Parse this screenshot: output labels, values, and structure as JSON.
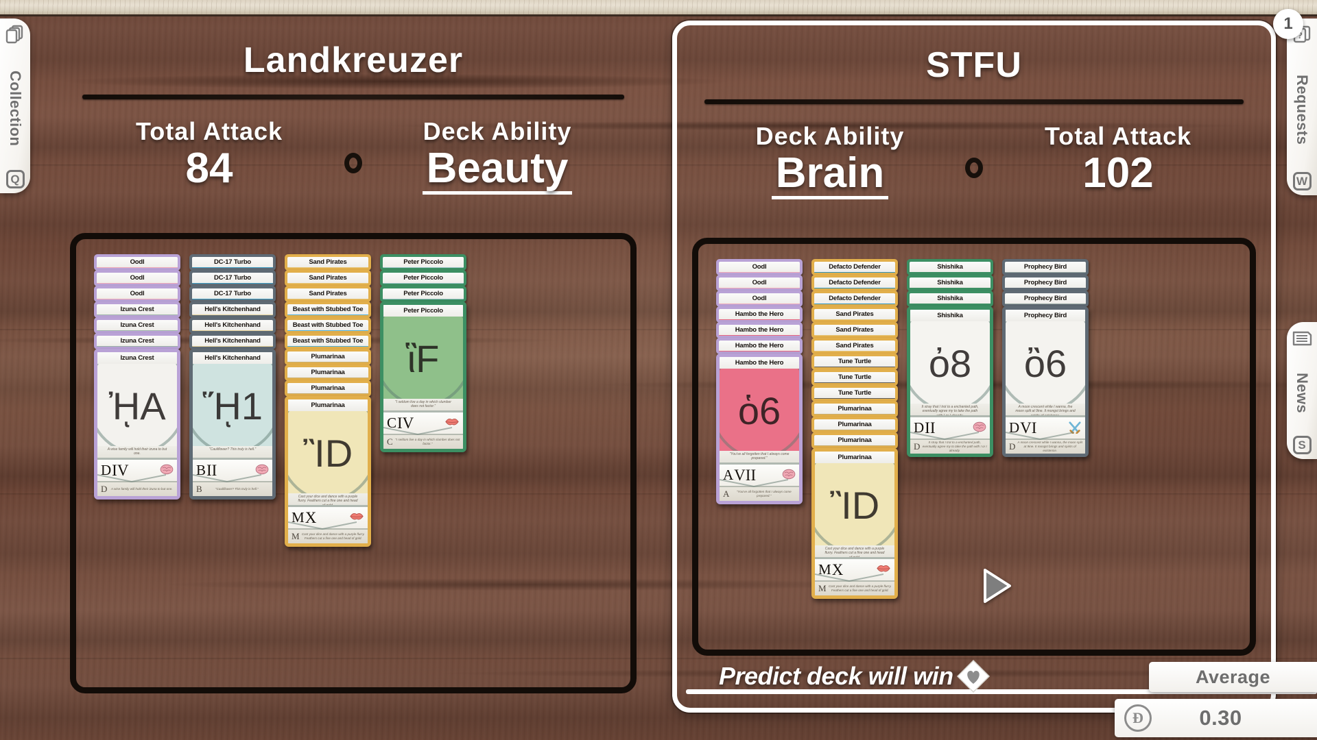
{
  "sidebar_left": {
    "tabs": [
      {
        "id": "collection",
        "label": "Collection",
        "key": "Q",
        "icon": "cards-stack-icon"
      }
    ]
  },
  "sidebar_right": {
    "tabs": [
      {
        "id": "requests",
        "label": "Requests",
        "key": "W",
        "icon": "question-cards-icon",
        "badge": "1"
      },
      {
        "id": "news",
        "label": "News",
        "key": "S",
        "icon": "newspaper-icon",
        "badge": ""
      }
    ]
  },
  "decks": [
    {
      "name": "Landkreuzer",
      "selected": false,
      "stats": [
        {
          "label": "Total Attack",
          "value": "84",
          "underlined": false
        },
        {
          "label": "Deck Ability",
          "value": "Beauty",
          "underlined": true
        }
      ],
      "stacks": [
        {
          "frame_color": "#b9a2d6",
          "art_color": "#f0aab8",
          "cards": [
            {
              "title": "Oodl",
              "art": "#f0aab8"
            },
            {
              "title": "Oodl",
              "art": "#f0aab8"
            },
            {
              "title": "Oodl",
              "art": "#f0aab8"
            },
            {
              "title": "Izuna Crest",
              "art": "#9db5a8"
            },
            {
              "title": "Izuna Crest",
              "art": "#9db5a8"
            },
            {
              "title": "Izuna Crest",
              "art": "#9db5a8"
            }
          ],
          "bottom": {
            "title": "Izuna Crest",
            "grade": "D",
            "numeral": "IV",
            "ability_icon": "brain-icon",
            "art_color": "#f3f2ee",
            "motif": "ᾘA",
            "quote": "A wise family will hold their izuna to but one."
          }
        },
        {
          "frame_color": "#5f6a74",
          "art_color": "#3f9ec4",
          "cards": [
            {
              "title": "DC-17 Turbo",
              "art": "#3f9ec4"
            },
            {
              "title": "DC-17 Turbo",
              "art": "#3f9ec4"
            },
            {
              "title": "DC-17 Turbo",
              "art": "#3f9ec4"
            },
            {
              "title": "Hell's Kitchenhand",
              "art": "#e6d39a"
            },
            {
              "title": "Hell's Kitchenhand",
              "art": "#e6d39a"
            },
            {
              "title": "Hell's Kitchenhand",
              "art": "#e6d39a"
            }
          ],
          "bottom": {
            "title": "Hell's Kitchenhand",
            "grade": "B",
            "numeral": "II",
            "ability_icon": "brain-icon",
            "art_color": "#cfe3e0",
            "motif": "ᾝ1",
            "quote": "\"Cauliflower? This truly is hell.\""
          }
        },
        {
          "frame_color": "#e2af4b",
          "art_color": "#e6c67a",
          "cards": [
            {
              "title": "Sand Pirates",
              "art": "#e6c67a"
            },
            {
              "title": "Sand Pirates",
              "art": "#e6c67a"
            },
            {
              "title": "Sand Pirates",
              "art": "#e6c67a"
            },
            {
              "title": "Beast with Stubbed Toe",
              "art": "#4fb0dc"
            },
            {
              "title": "Beast with Stubbed Toe",
              "art": "#4fb0dc"
            },
            {
              "title": "Beast with Stubbed Toe",
              "art": "#4fb0dc"
            },
            {
              "title": "Plumarinaa",
              "art": "#c9ae6e"
            },
            {
              "title": "Plumarinaa",
              "art": "#c9ae6e"
            },
            {
              "title": "Plumarinaa",
              "art": "#c9ae6e"
            }
          ],
          "bottom": {
            "title": "Plumarinaa",
            "grade": "M",
            "numeral": "X",
            "ability_icon": "lips-icon",
            "art_color": "#f0e6b8",
            "motif": "ἺD",
            "quote": "Cast your dice and dance with a purple flurry. Feathers cut a fine one and head of gold."
          }
        },
        {
          "frame_color": "#3c8f63",
          "art_color": "#7fbf86",
          "cards": [
            {
              "title": "Peter Piccolo",
              "art": "#9dc6c8"
            },
            {
              "title": "Peter Piccolo",
              "art": "#9dc6c8"
            },
            {
              "title": "Peter Piccolo",
              "art": "#9dc6c8"
            }
          ],
          "bottom": {
            "title": "Peter Piccolo",
            "grade": "C",
            "numeral": "IV",
            "ability_icon": "lips-icon",
            "art_color": "#8fc08a",
            "motif": "ἳF",
            "quote": "\"I seldom live a day in which slumber does not factor.\""
          }
        }
      ]
    },
    {
      "name": "STFU",
      "selected": true,
      "stats": [
        {
          "label": "Deck Ability",
          "value": "Brain",
          "underlined": true
        },
        {
          "label": "Total Attack",
          "value": "102",
          "underlined": false
        }
      ],
      "stacks": [
        {
          "frame_color": "#b9a2d6",
          "art_color": "#f0aab8",
          "cards": [
            {
              "title": "Oodl",
              "art": "#f0aab8"
            },
            {
              "title": "Oodl",
              "art": "#f0aab8"
            },
            {
              "title": "Oodl",
              "art": "#f0aab8"
            },
            {
              "title": "Hambo the Hero",
              "art": "#e8687f"
            },
            {
              "title": "Hambo the Hero",
              "art": "#e8687f"
            },
            {
              "title": "Hambo the Hero",
              "art": "#e8687f"
            }
          ],
          "bottom": {
            "title": "Hambo the Hero",
            "grade": "A",
            "numeral": "VII",
            "ability_icon": "brain-icon",
            "art_color": "#ea7188",
            "motif": "ὁ6",
            "quote": "\"You've all forgotten that I always come prepared.\""
          }
        },
        {
          "frame_color": "#e2af4b",
          "art_color": "#2f93bd",
          "cards": [
            {
              "title": "Defacto Defender",
              "art": "#2f93bd"
            },
            {
              "title": "Defacto Defender",
              "art": "#2f93bd"
            },
            {
              "title": "Defacto Defender",
              "art": "#2f93bd"
            },
            {
              "title": "Sand Pirates",
              "art": "#e6c67a"
            },
            {
              "title": "Sand Pirates",
              "art": "#e6c67a"
            },
            {
              "title": "Sand Pirates",
              "art": "#e6c67a"
            },
            {
              "title": "Tune Turtle",
              "art": "#5b5b5b"
            },
            {
              "title": "Tune Turtle",
              "art": "#5b5b5b"
            },
            {
              "title": "Tune Turtle",
              "art": "#5b5b5b"
            },
            {
              "title": "Plumarinaa",
              "art": "#c9ae6e"
            },
            {
              "title": "Plumarinaa",
              "art": "#c9ae6e"
            },
            {
              "title": "Plumarinaa",
              "art": "#c9ae6e"
            }
          ],
          "bottom": {
            "title": "Plumarinaa",
            "grade": "M",
            "numeral": "X",
            "ability_icon": "lips-icon",
            "art_color": "#f0e6b8",
            "motif": "ἺD",
            "quote": "Cast your dice and dance with a purple flurry. Feathers cut a fine one and head of gold."
          }
        },
        {
          "frame_color": "#3c8f63",
          "art_color": "#3c8f63",
          "cards": [
            {
              "title": "Shishika",
              "art": "#3c8f63"
            },
            {
              "title": "Shishika",
              "art": "#3c8f63"
            },
            {
              "title": "Shishika",
              "art": "#3c8f63"
            }
          ],
          "bottom": {
            "title": "Shishika",
            "grade": "D",
            "numeral": "II",
            "ability_icon": "brain-icon",
            "art_color": "#f5f4f0",
            "motif": "ὀ8",
            "quote": "It stray that I trot to a enchanted path, eventually agree my to take the path with I or I already."
          }
        },
        {
          "frame_color": "#5f6a74",
          "art_color": "#9aa9a4",
          "cards": [
            {
              "title": "Prophecy Bird",
              "art": "#9aa9a4"
            },
            {
              "title": "Prophecy Bird",
              "art": "#5f6a74"
            },
            {
              "title": "Prophecy Bird",
              "art": "#9aa9a4"
            }
          ],
          "bottom": {
            "title": "Prophecy Bird",
            "grade": "D",
            "numeral": "VI",
            "ability_icon": "swords-icon",
            "art_color": "#f4f3ef",
            "motif": "ὂ6",
            "quote": "A moon crescent while I wanna, the moon split at 9ine. It mongst brings and spirits of existence."
          }
        }
      ]
    }
  ],
  "prediction": {
    "text": "Predict deck will win",
    "icon": "heart-diamond-icon",
    "status": "Average",
    "cost_symbol": "Đ",
    "cost_value": "0.30"
  },
  "cursor": {
    "icon": "arrow-cursor-icon"
  }
}
